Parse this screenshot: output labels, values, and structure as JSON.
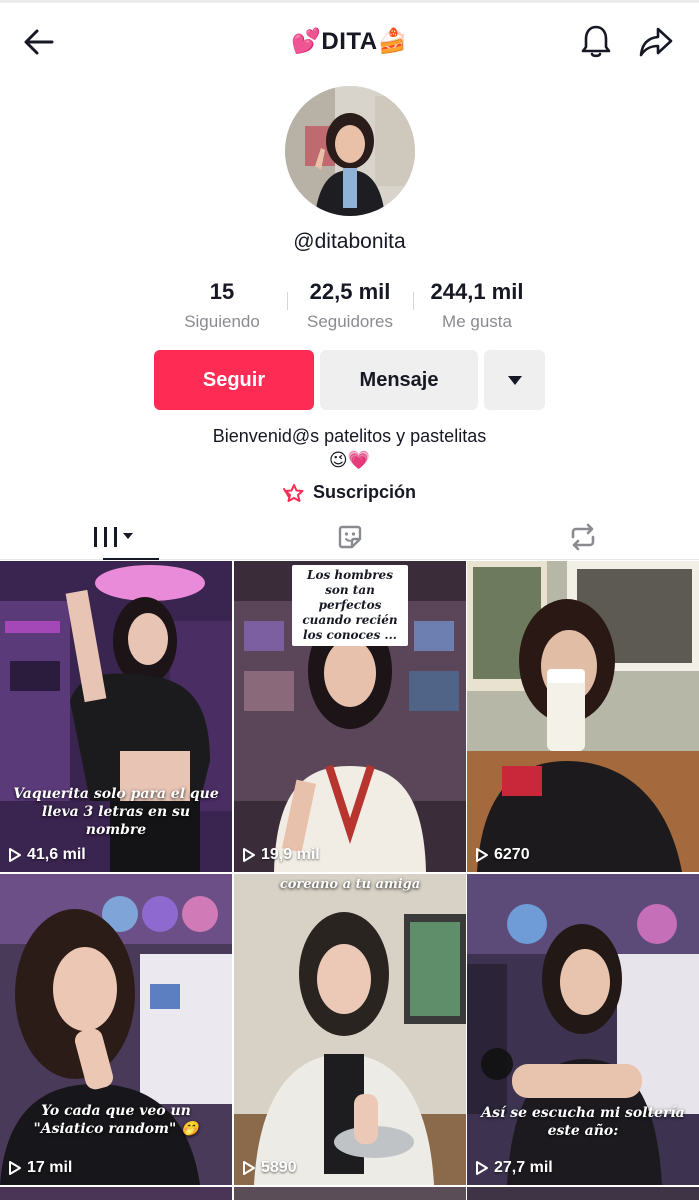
{
  "header": {
    "title": "💕DITA🍰",
    "icons": {
      "back": "arrow-left-icon",
      "notifications": "bell-icon",
      "share": "share-arrow-icon"
    }
  },
  "profile": {
    "username": "@ditabonita",
    "avatar": "avatar-photo"
  },
  "stats": [
    {
      "value": "15",
      "label": "Siguiendo"
    },
    {
      "value": "22,5 mil",
      "label": "Seguidores"
    },
    {
      "value": "244,1 mil",
      "label": "Me gusta"
    }
  ],
  "actions": {
    "follow_label": "Seguir",
    "message_label": "Mensaje"
  },
  "bio": {
    "line1": "Bienvenid@s patelitos y pastelitas",
    "line2": "😉💗",
    "subscription_label": "Suscripción"
  },
  "tabs": [
    "videos-grid-icon",
    "liked-sticker-icon",
    "repost-icon"
  ],
  "videos": [
    {
      "views": "41,6 mil",
      "caption": "Vaquerita solo para el que lleva 3 letras en su nombre"
    },
    {
      "views": "19,9 mil",
      "caption": "Los hombres son tan perfectos\ncuando recién los conoces ..."
    },
    {
      "views": "6270",
      "caption": ""
    },
    {
      "views": "17 mil",
      "caption": "Yo cada que veo un \"Asiatico random\" 🤭"
    },
    {
      "views": "5890",
      "caption": "coreano a tu amiga"
    },
    {
      "views": "27,7 mil",
      "caption": "Así se escucha mi soltería este año:"
    }
  ],
  "colors": {
    "accent": "#fe2c55",
    "text": "#161823",
    "muted": "#8a8b91",
    "button_bg": "#efeff0"
  }
}
